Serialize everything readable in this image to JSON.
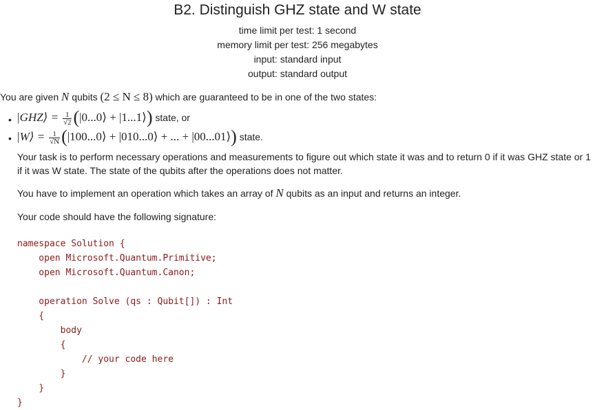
{
  "problem": {
    "title": "B2. Distinguish GHZ state and W state",
    "time_limit": "time limit per test: 1 second",
    "memory_limit": "memory limit per test: 256 megabytes",
    "input": "input: standard input",
    "output": "output: standard output"
  },
  "statement": {
    "intro_before": "You are given",
    "intro_n": "N",
    "intro_middle": "qubits",
    "intro_constraint": "(2 ≤ N ≤ 8)",
    "intro_after": "which are guaranteed to be in one of the two states:",
    "ghz_lhs": "|GHZ⟩ =",
    "ghz_frac_num": "1",
    "ghz_frac_den": "√2",
    "ghz_paren_open": "(",
    "ghz_body": "|0...0⟩ + |1...1⟩",
    "ghz_paren_close": ")",
    "ghz_suffix": "state, or",
    "w_lhs": "|W⟩ =",
    "w_frac_num": "1",
    "w_frac_den": "√N",
    "w_paren_open": "(",
    "w_body": "|100...0⟩ + |010...0⟩ + ... + |00...01⟩",
    "w_paren_close": ")",
    "w_suffix": "state.",
    "task_line1": "Your task is to perform necessary operations and measurements to figure out which state it was and to return 0 if it was GHZ state or 1",
    "task_line2": "if it was W state. The state of the qubits after the operations does not matter.",
    "impl_before": "You have to implement an operation which takes an array of",
    "impl_n": "N",
    "impl_after": "qubits as an input and returns an integer.",
    "signature_intro": "Your code should have the following signature:"
  },
  "code_lines": [
    "namespace Solution {",
    "    open Microsoft.Quantum.Primitive;",
    "    open Microsoft.Quantum.Canon;",
    "",
    "    operation Solve (qs : Qubit[]) : Int",
    "    {",
    "        body",
    "        {",
    "            // your code here",
    "        }",
    "    }",
    "}"
  ],
  "colors": {
    "text": "#222222",
    "code": "#8b1a1a"
  }
}
